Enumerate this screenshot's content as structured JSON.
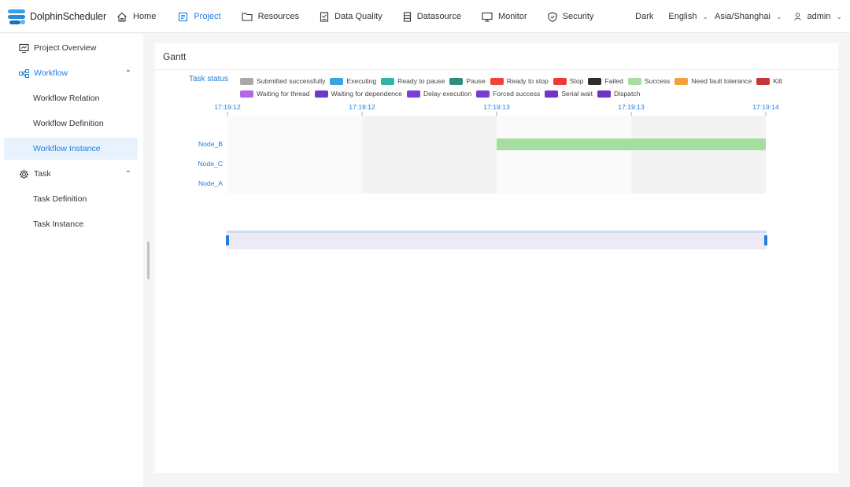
{
  "app": {
    "name": "DolphinScheduler"
  },
  "nav": {
    "items": [
      {
        "label": "Home",
        "icon": "home-icon",
        "active": false
      },
      {
        "label": "Project",
        "icon": "project-icon",
        "active": true
      },
      {
        "label": "Resources",
        "icon": "folder-icon",
        "active": false
      },
      {
        "label": "Data Quality",
        "icon": "data-quality-icon",
        "active": false
      },
      {
        "label": "Datasource",
        "icon": "datasource-icon",
        "active": false
      },
      {
        "label": "Monitor",
        "icon": "monitor-icon",
        "active": false
      },
      {
        "label": "Security",
        "icon": "shield-icon",
        "active": false
      }
    ],
    "theme_label": "Dark",
    "language": "English",
    "timezone": "Asia/Shanghai",
    "user": "admin"
  },
  "sidebar": {
    "items": [
      {
        "label": "Project Overview",
        "icon": "project-overview-icon"
      },
      {
        "label": "Workflow",
        "icon": "workflow-icon"
      },
      {
        "label": "Workflow Relation"
      },
      {
        "label": "Workflow Definition"
      },
      {
        "label": "Workflow Instance"
      },
      {
        "label": "Task",
        "icon": "gear-icon"
      },
      {
        "label": "Task Definition"
      },
      {
        "label": "Task Instance"
      }
    ]
  },
  "gantt": {
    "title": "Gantt",
    "legend_label": "Task status",
    "statuses": [
      {
        "label": "Submitted successfully",
        "color": "#a9a9a9"
      },
      {
        "label": "Executing",
        "color": "#3aa3e3"
      },
      {
        "label": "Ready to pause",
        "color": "#33b5a5"
      },
      {
        "label": "Pause",
        "color": "#2f8d80"
      },
      {
        "label": "Ready to stop",
        "color": "#f0433a"
      },
      {
        "label": "Stop",
        "color": "#f03a3a"
      },
      {
        "label": "Failed",
        "color": "#2e2e2e"
      },
      {
        "label": "Success",
        "color": "#a6dea0"
      },
      {
        "label": "Need fault tolerance",
        "color": "#f5a038"
      },
      {
        "label": "Kill",
        "color": "#c23838"
      },
      {
        "label": "Waiting for thread",
        "color": "#b166ee"
      },
      {
        "label": "Waiting for dependence",
        "color": "#6d3bc8"
      },
      {
        "label": "Delay execution",
        "color": "#7c3ed8"
      },
      {
        "label": "Forced success",
        "color": "#7a3ad6"
      },
      {
        "label": "Serial wait",
        "color": "#7035c8"
      },
      {
        "label": "Dispatch",
        "color": "#6c34c2"
      }
    ]
  },
  "chart_data": {
    "type": "gantt",
    "x_ticks": [
      "17:19:12",
      "17:19:12",
      "17:19:13",
      "17:19:13",
      "17:19:14"
    ],
    "tasks": [
      "Node_B",
      "Node_C",
      "Node_A"
    ],
    "bars": [
      {
        "task": "Node_B",
        "status": "Success",
        "start_tick": 2,
        "end_tick": 4
      }
    ],
    "success_color": "#a6dea0"
  }
}
